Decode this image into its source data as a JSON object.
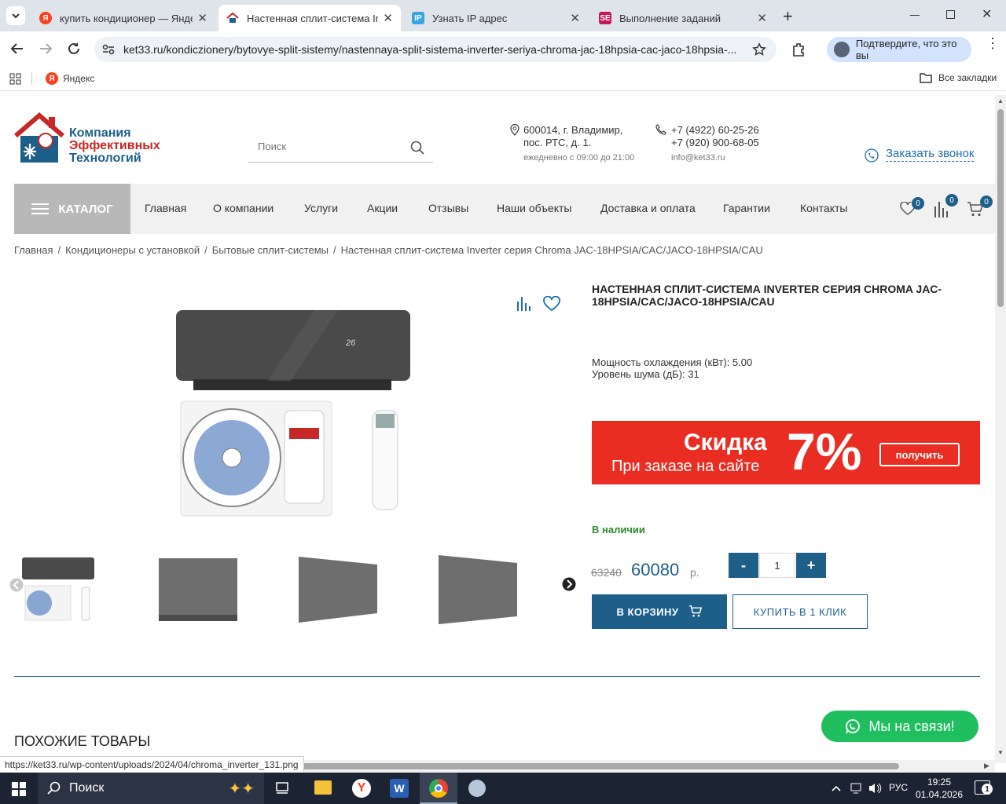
{
  "tabs": [
    {
      "title": "купить кондиционер — Яндекс",
      "favicon": "Я",
      "color": "#fc3f1d"
    },
    {
      "title": "Настенная сплит-система Inverter",
      "favicon": "house",
      "color": "#c03"
    },
    {
      "title": "Узнать IP адрес",
      "favicon": "IP",
      "color": "#3aa3e3"
    },
    {
      "title": "Выполнение заданий",
      "favicon": "SE",
      "color": "#c2185b"
    }
  ],
  "address": "ket33.ru/kondicziоnery/bytovye-split-sistemy/nastennaya-split-sistema-inverter-seriya-chroma-jac-18hpsia-cac-jaco-18hpsia-...",
  "profile_prompt": "Подтвердите, что это вы",
  "bookmarks": {
    "yandex": "Яндекс",
    "all": "Все закладки"
  },
  "site": {
    "logo_lines": [
      "Компания",
      "Эффективных",
      "Технологий"
    ],
    "search_placeholder": "Поиск",
    "address_line1": "600014, г. Владимир,",
    "address_line2": "пос. РТС, д. 1.",
    "hours": "ежедневно с 09:00 до 21:00",
    "phone1": "+7 (4922) 60-25-26",
    "phone2": "+7 (920) 900-68-05",
    "email": "info@ket33.ru",
    "callback": "Заказать звонок",
    "catalog": "КАТАЛОГ",
    "nav": [
      "Главная",
      "О компании",
      "Услуги",
      "Акции",
      "Отзывы",
      "Наши объекты",
      "Доставка и оплата",
      "Гарантии",
      "Контакты"
    ],
    "badges": {
      "favorites": "0",
      "compare": "0",
      "cart": "0"
    }
  },
  "breadcrumbs": [
    "Главная",
    "Кондиционеры с установкой",
    "Бытовые сплит-системы",
    "Настенная сплит-система Inverter серия Chroma JAC-18HPSIA/CAC/JACO-18HPSIA/CAU"
  ],
  "product": {
    "title": "НАСТЕННАЯ СПЛИТ-СИСТЕМА INVERTER СЕРИЯ CHROMA JAC-18HPSIA/CAC/JACO-18HPSIA/CAU",
    "spec1": "Мощность охлаждения (кВт): 5.00",
    "spec2": "Уровень шума (дБ): 31",
    "promo_big": "Скидка",
    "promo_small": "При заказе на сайте",
    "promo_percent": "7%",
    "promo_button": "получить",
    "stock": "В наличии",
    "old_price": "63240",
    "price": "60080",
    "currency": "р.",
    "qty": "1",
    "minus": "-",
    "plus": "+",
    "add_to_cart": "В КОРЗИНУ",
    "buy_one_click": "КУПИТЬ В 1 КЛИК",
    "display_temp": "26"
  },
  "similar_heading": "ПОХОЖИЕ ТОВАРЫ",
  "chat_button": "Мы на связи!",
  "status_url": "https://ket33.ru/wp-content/uploads/2024/04/chroma_inverter_131.png",
  "taskbar": {
    "search": "Поиск",
    "lang": "РУС",
    "time": "19:25",
    "date": "01.04.2026",
    "notif": "1"
  }
}
